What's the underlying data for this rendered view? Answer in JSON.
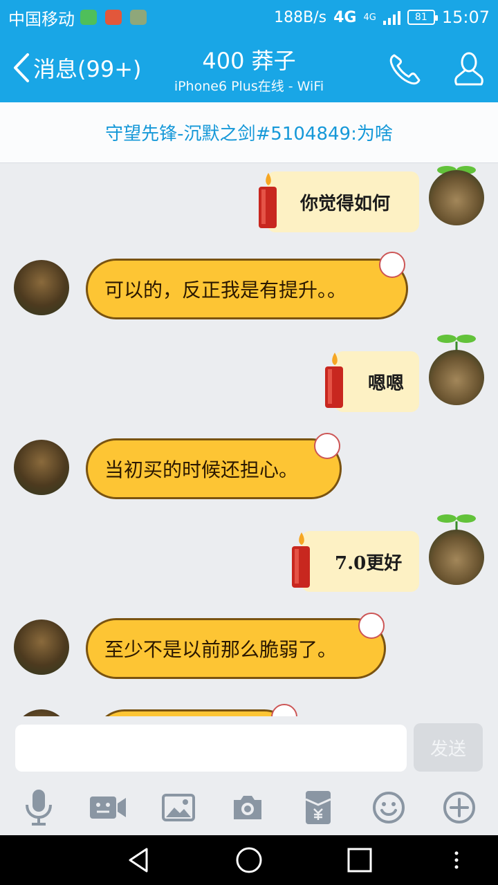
{
  "status_bar": {
    "carrier": "中国移动",
    "net_speed": "188B/s",
    "network": "4G",
    "network_small": "4G",
    "battery": "81",
    "time": "15:07"
  },
  "header": {
    "back_label": "消息(99+)",
    "title": "400 莽子",
    "subtitle": "iPhone6 Plus在线 - WiFi"
  },
  "notice": {
    "text": "守望先锋-沉默之剑#5104849:为啥"
  },
  "messages": [
    {
      "side": "me",
      "text": "你觉得如何"
    },
    {
      "side": "other",
      "text": "可以的，反正我是有提升。。"
    },
    {
      "side": "me",
      "text": "嗯嗯"
    },
    {
      "side": "other",
      "text": "当初买的时候还担心。"
    },
    {
      "side": "me",
      "text": "7.0更好"
    },
    {
      "side": "other",
      "text": "至少不是以前那么脆弱了。"
    }
  ],
  "input": {
    "value": "",
    "send_label": "发送"
  },
  "toolbar": {
    "icons": [
      "microphone-icon",
      "video-icon",
      "image-icon",
      "camera-icon",
      "red-packet-icon",
      "emoji-icon",
      "plus-icon"
    ]
  },
  "colors": {
    "primary": "#19a6e6",
    "bubble_other": "#fdc534",
    "bubble_me": "#fdf1c4"
  }
}
